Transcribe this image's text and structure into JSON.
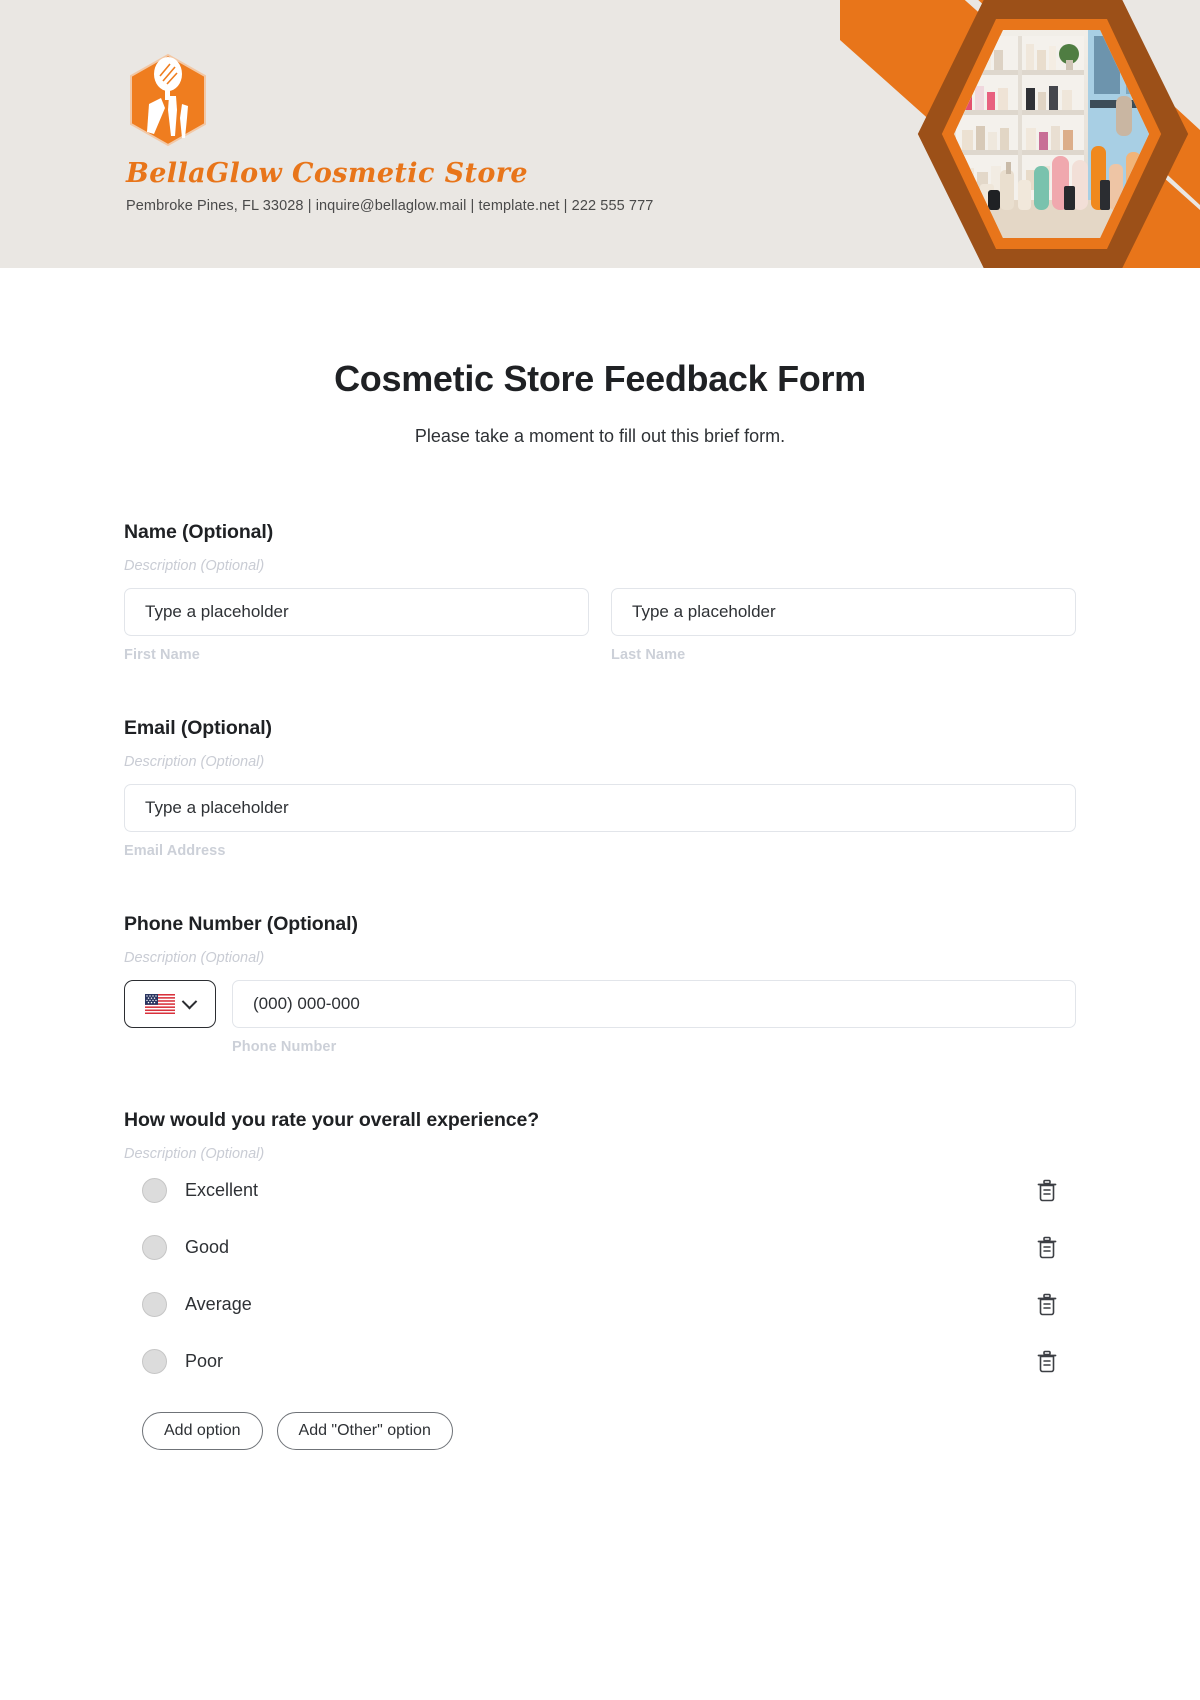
{
  "header": {
    "brand_name": "BellaGlow Cosmetic Store",
    "contact_line": "Pembroke Pines, FL 33028 | inquire@bellaglow.mail | template.net | 222 555 777",
    "logo_icon": "cosmetic-brushes-hexagon-logo",
    "photo_icon": "cosmetic-store-shelf-photo",
    "colors": {
      "background": "#eae7e3",
      "accent_orange": "#e8751a",
      "accent_brown": "#9c5018",
      "brand_text": "#e8751a"
    }
  },
  "form": {
    "title": "Cosmetic Store Feedback Form",
    "subtitle": "Please take a moment to fill out this brief form.",
    "description_placeholder": "Description (Optional)",
    "fields": [
      {
        "label": "Name (Optional)",
        "description": "Description (Optional)",
        "inputs": [
          {
            "placeholder": "Type a placeholder",
            "sub_label": "First Name"
          },
          {
            "placeholder": "Type a placeholder",
            "sub_label": "Last Name"
          }
        ]
      },
      {
        "label": "Email (Optional)",
        "description": "Description (Optional)",
        "inputs": [
          {
            "placeholder": "Type a placeholder",
            "sub_label": "Email Address"
          }
        ]
      },
      {
        "label": "Phone Number (Optional)",
        "description": "Description (Optional)",
        "country_flag": "us-flag-icon",
        "dropdown_icon": "chevron-down-icon",
        "inputs": [
          {
            "placeholder": "(000) 000-000",
            "sub_label": "Phone Number"
          }
        ]
      }
    ],
    "rating_question": {
      "label": "How would you rate your overall experience?",
      "description": "Description (Optional)",
      "options": [
        {
          "label": "Excellent",
          "delete_icon": "trash-icon"
        },
        {
          "label": "Good",
          "delete_icon": "trash-icon"
        },
        {
          "label": "Average",
          "delete_icon": "trash-icon"
        },
        {
          "label": "Poor",
          "delete_icon": "trash-icon"
        }
      ],
      "buttons": [
        {
          "label": "Add option"
        },
        {
          "label": "Add \"Other\" option"
        }
      ]
    }
  }
}
